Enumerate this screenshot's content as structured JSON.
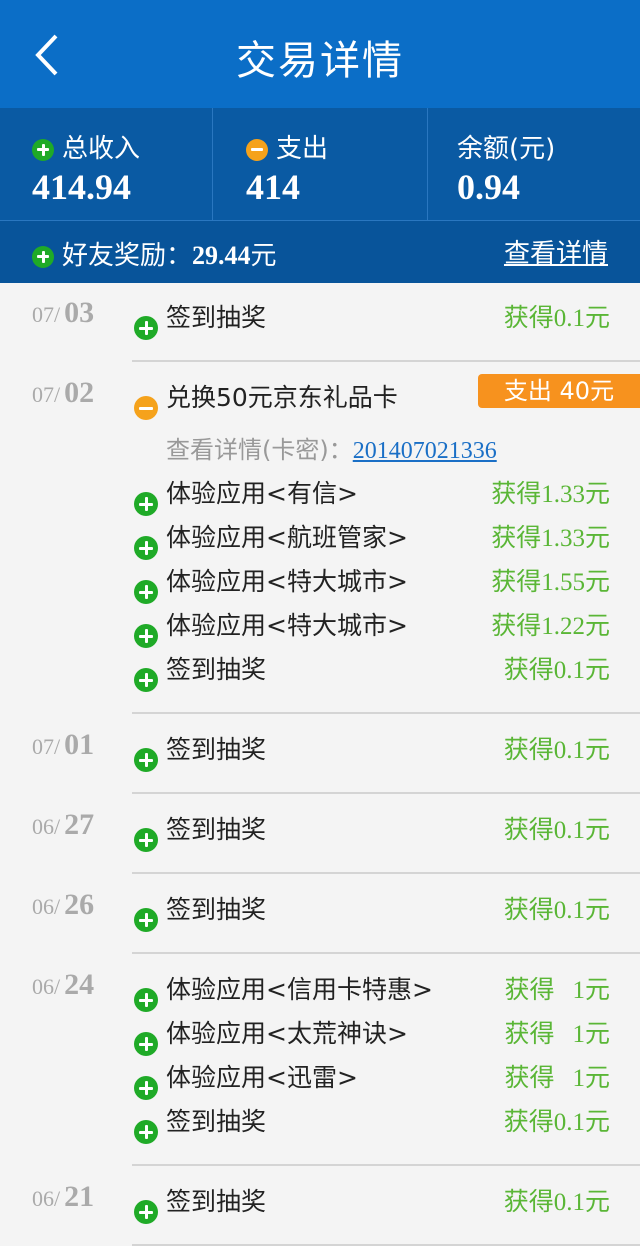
{
  "header": {
    "title": "交易详情",
    "back_icon": "chevron-left-icon"
  },
  "summary": {
    "income_label": "总收入",
    "income_value": "414.94",
    "expense_label": "支出",
    "expense_value": "414",
    "balance_label": "余额(元)",
    "balance_value": "0.94",
    "friend_label": "好友奖励：",
    "friend_value": "29.44",
    "friend_unit": "元",
    "detail_link": "查看详情"
  },
  "groups": [
    {
      "month": "07/",
      "day": "03",
      "items": [
        {
          "title": "签到抽奖",
          "amount_prefix": "获得",
          "amount": "0.1元"
        }
      ]
    },
    {
      "month": "07/",
      "day": "02",
      "expense": {
        "title": "兑换50元京东礼品卡",
        "badge": "支出 40元",
        "detail_label": "查看详情(卡密)：",
        "detail_code": "201407021336"
      },
      "items": [
        {
          "title": "体验应用<有信>",
          "amount_prefix": "获得",
          "amount": "1.33元"
        },
        {
          "title": "体验应用<航班管家>",
          "amount_prefix": "获得",
          "amount": "1.33元"
        },
        {
          "title": "体验应用<特大城市>",
          "amount_prefix": "获得",
          "amount": "1.55元"
        },
        {
          "title": "体验应用<特大城市>",
          "amount_prefix": "获得",
          "amount": "1.22元"
        },
        {
          "title": "签到抽奖",
          "amount_prefix": "获得",
          "amount": "0.1元"
        }
      ]
    },
    {
      "month": "07/",
      "day": "01",
      "items": [
        {
          "title": "签到抽奖",
          "amount_prefix": "获得",
          "amount": "0.1元"
        }
      ]
    },
    {
      "month": "06/",
      "day": "27",
      "items": [
        {
          "title": "签到抽奖",
          "amount_prefix": "获得",
          "amount": "0.1元"
        }
      ]
    },
    {
      "month": "06/",
      "day": "26",
      "items": [
        {
          "title": "签到抽奖",
          "amount_prefix": "获得",
          "amount": "0.1元"
        }
      ]
    },
    {
      "month": "06/",
      "day": "24",
      "items": [
        {
          "title": "体验应用<信用卡特惠>",
          "amount_prefix": "获得",
          "amount": "1元"
        },
        {
          "title": "体验应用<太荒神诀>",
          "amount_prefix": "获得",
          "amount": "1元"
        },
        {
          "title": "体验应用<迅雷>",
          "amount_prefix": "获得",
          "amount": "1元"
        },
        {
          "title": "签到抽奖",
          "amount_prefix": "获得",
          "amount": "0.1元"
        }
      ]
    },
    {
      "month": "06/",
      "day": "21",
      "items": [
        {
          "title": "签到抽奖",
          "amount_prefix": "获得",
          "amount": "0.1元"
        }
      ]
    }
  ],
  "colors": {
    "header": "#0b6ec7",
    "summary": "#0a5aa3",
    "income": "#1faa27",
    "expense": "#f7921e",
    "amount": "#5ab636",
    "link": "#1a6fc6"
  }
}
